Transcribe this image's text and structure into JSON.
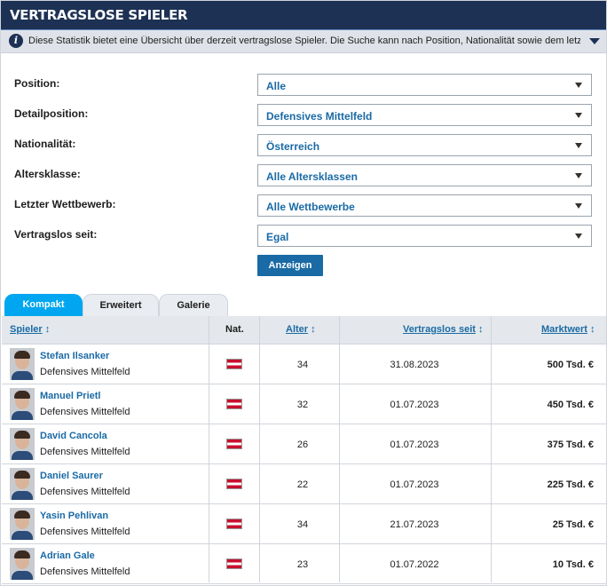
{
  "header": {
    "title": "VERTRAGSLOSE SPIELER"
  },
  "info": {
    "text": "Diese Statistik bietet eine Übersicht über derzeit vertragslose Spieler. Die Suche kann nach Position, Nationalität sowie dem letzten Wettbew…"
  },
  "filters": [
    {
      "label": "Position:",
      "value": "Alle"
    },
    {
      "label": "Detailposition:",
      "value": "Defensives Mittelfeld"
    },
    {
      "label": "Nationalität:",
      "value": "Österreich"
    },
    {
      "label": "Altersklasse:",
      "value": "Alle Altersklassen"
    },
    {
      "label": "Letzter Wettbewerb:",
      "value": "Alle Wettbewerbe"
    },
    {
      "label": "Vertragslos seit:",
      "value": "Egal"
    }
  ],
  "button": {
    "label": "Anzeigen"
  },
  "tabs": [
    "Kompakt",
    "Erweitert",
    "Galerie"
  ],
  "table": {
    "columns": {
      "player": "Spieler",
      "nat": "Nat.",
      "age": "Alter",
      "since": "Vertragslos seit",
      "value": "Marktwert"
    },
    "sort_glyph": "↕",
    "rows": [
      {
        "name": "Stefan Ilsanker",
        "position": "Defensives Mittelfeld",
        "age": "34",
        "since": "31.08.2023",
        "value": "500 Tsd. €"
      },
      {
        "name": "Manuel Prietl",
        "position": "Defensives Mittelfeld",
        "age": "32",
        "since": "01.07.2023",
        "value": "450 Tsd. €"
      },
      {
        "name": "David Cancola",
        "position": "Defensives Mittelfeld",
        "age": "26",
        "since": "01.07.2023",
        "value": "375 Tsd. €"
      },
      {
        "name": "Daniel Saurer",
        "position": "Defensives Mittelfeld",
        "age": "22",
        "since": "01.07.2023",
        "value": "225 Tsd. €"
      },
      {
        "name": "Yasin Pehlivan",
        "position": "Defensives Mittelfeld",
        "age": "34",
        "since": "21.07.2023",
        "value": "25 Tsd. €"
      },
      {
        "name": "Adrian Gale",
        "position": "Defensives Mittelfeld",
        "age": "23",
        "since": "01.07.2022",
        "value": "10 Tsd. €"
      }
    ]
  },
  "colors": {
    "header": "#1d3154",
    "accent": "#1a6aa5",
    "tab_active": "#00a6f0"
  }
}
